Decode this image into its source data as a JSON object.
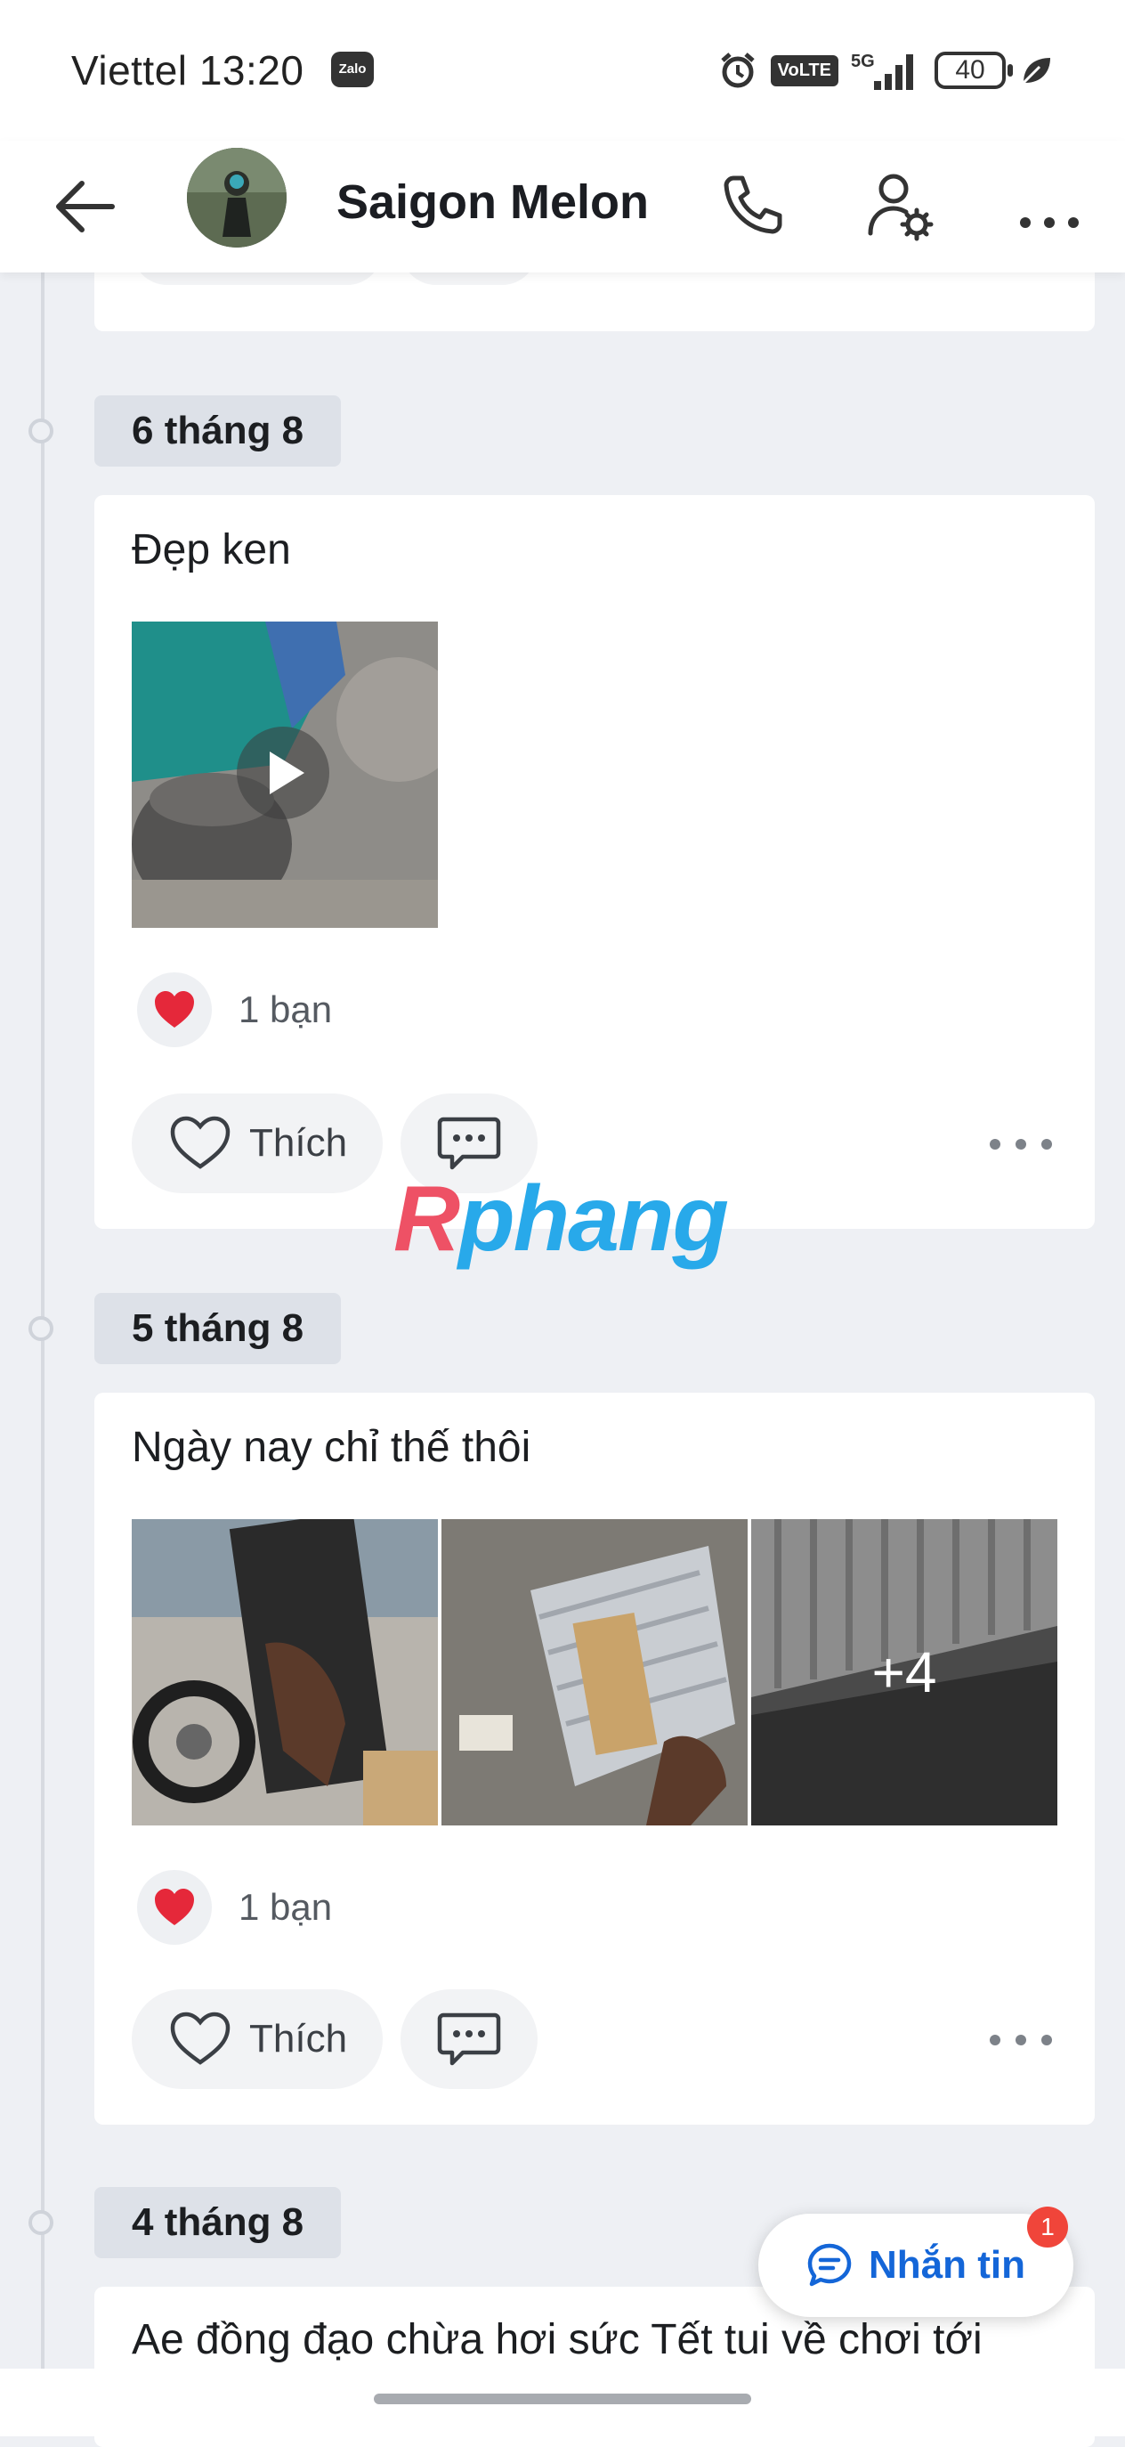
{
  "status_bar": {
    "carrier": "Viettel",
    "time": "13:20",
    "app_badge": "Zalo",
    "network_badge": "VoLTE",
    "network_type": "5G",
    "battery": "40"
  },
  "header": {
    "title": "Saigon Melon"
  },
  "posts": [
    {
      "date": "6 tháng 8",
      "text": "Đẹp ken",
      "reaction_count": "1 bạn",
      "like_label": "Thích"
    },
    {
      "date": "5 tháng 8",
      "text": "Ngày nay chỉ thế thôi",
      "reaction_count": "1 bạn",
      "like_label": "Thích",
      "more_photos": "+4"
    },
    {
      "date": "4 tháng 8",
      "text": "Ae đồng đạo chừa hơi sức Tết tui về chơi tới"
    }
  ],
  "floating_button": {
    "label": "Nhắn tin",
    "badge": "1"
  },
  "watermark": {
    "first": "R",
    "rest": "phang"
  },
  "colors": {
    "accent": "#1466d8",
    "heart": "#e5283a",
    "badge": "#f0453a"
  }
}
